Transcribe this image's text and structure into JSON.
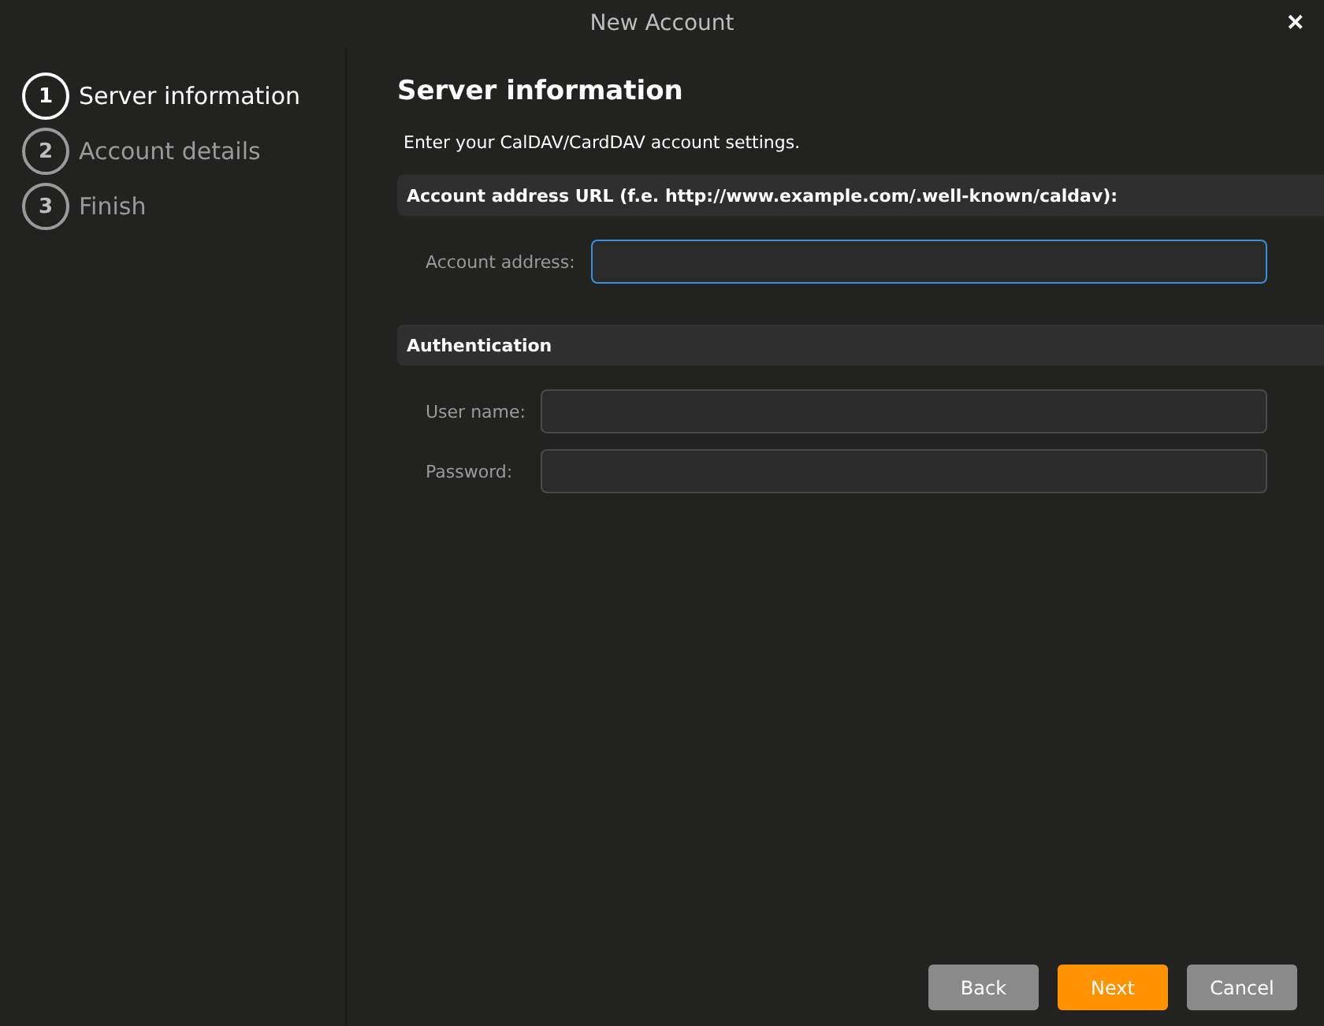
{
  "window": {
    "title": "New Account",
    "close": "✕"
  },
  "steps": [
    {
      "number": "1",
      "label": "Server information",
      "selected": true
    },
    {
      "number": "2",
      "label": "Account details",
      "selected": false
    },
    {
      "number": "3",
      "label": "Finish",
      "selected": false
    }
  ],
  "page": {
    "heading": "Server information",
    "intro": "Enter your CalDAV/CardDAV account settings."
  },
  "sections": [
    {
      "title": "Account address URL (f.e. http://www.example.com/.well-known/caldav):",
      "fields": [
        {
          "label": "Account address:",
          "focused": true
        }
      ]
    },
    {
      "title": "Authentication",
      "fields": [
        {
          "label": "User name:",
          "focused": false
        },
        {
          "label": "Password:",
          "focused": false
        }
      ]
    }
  ],
  "buttons": [
    {
      "label": "Back",
      "kind": "secondary"
    },
    {
      "label": "Next",
      "kind": "primary"
    },
    {
      "label": "Cancel",
      "kind": "secondary"
    }
  ]
}
